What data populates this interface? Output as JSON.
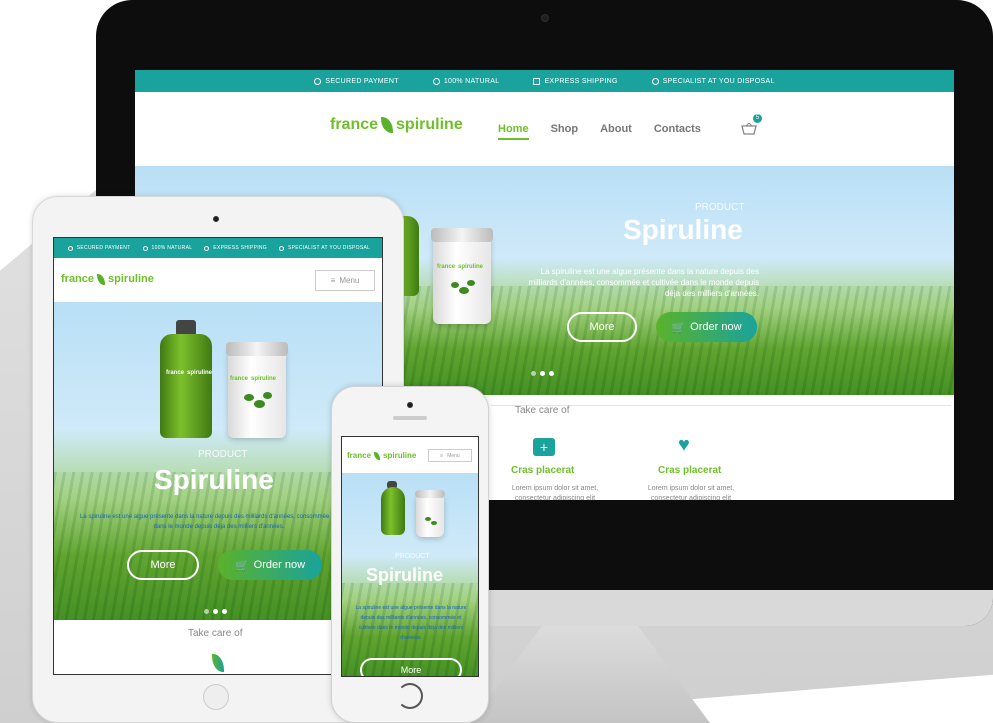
{
  "topbar": {
    "items": [
      "SECURED PAYMENT",
      "100% NATURAL",
      "EXPRESS SHIPPING",
      "SPECIALIST AT YOU DISPOSAL"
    ]
  },
  "brand": {
    "name_left": "france",
    "name_right": "spiruline"
  },
  "nav": {
    "items": [
      "Home",
      "Shop",
      "About",
      "Contacts"
    ],
    "active": "Home",
    "cart_count": "5"
  },
  "hero": {
    "kicker": "PRODUCT",
    "title": "Spiruline",
    "text": "La spiruline est une algue présente dans la nature depuis des milliards d'années, consommée et cultivée dans le monde depuis déja des milliers d'années.",
    "more_label": "More",
    "order_label": "Order now"
  },
  "section": {
    "take_care": "Take care of",
    "features": [
      {
        "title": "Cras placerat",
        "text": "Lorem ipsum dolor sit amet, consectetur adipiscing elit"
      },
      {
        "title": "Cras placerat",
        "text": "Lorem ipsum dolor sit amet, consectetur adipiscing elit"
      }
    ]
  },
  "tablet": {
    "menu_label": "Menu"
  },
  "phone": {
    "menu_label": "Menu"
  },
  "colors": {
    "teal": "#1aa39c",
    "green": "#6fbf2a",
    "dark_green": "#3d8a1e"
  }
}
